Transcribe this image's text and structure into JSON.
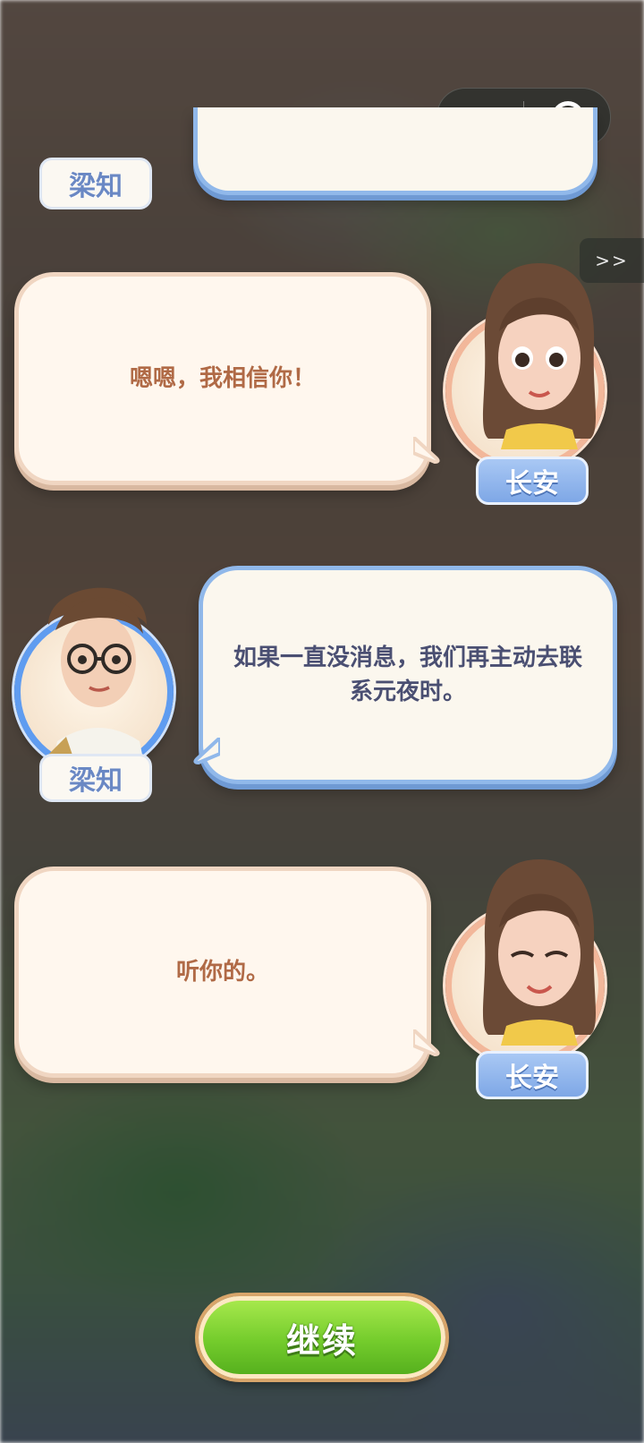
{
  "top_bar": {
    "more_icon": "more-dots-icon",
    "close_icon": "target-close-icon"
  },
  "skip": {
    "label": ">>"
  },
  "dialogue": [
    {
      "speaker": "梁知",
      "text": ""
    },
    {
      "speaker": "长安",
      "text": "嗯嗯，我相信你！"
    },
    {
      "speaker": "梁知",
      "text": "如果一直没消息，我们再主动去联系元夜时。"
    },
    {
      "speaker": "长安",
      "text": "听你的。"
    }
  ],
  "continue_button": {
    "label": "继续"
  },
  "colors": {
    "warm_bubble_text": "#b06a46",
    "cool_bubble_text": "#4a4f72",
    "continue_green": "#74cc2c"
  }
}
